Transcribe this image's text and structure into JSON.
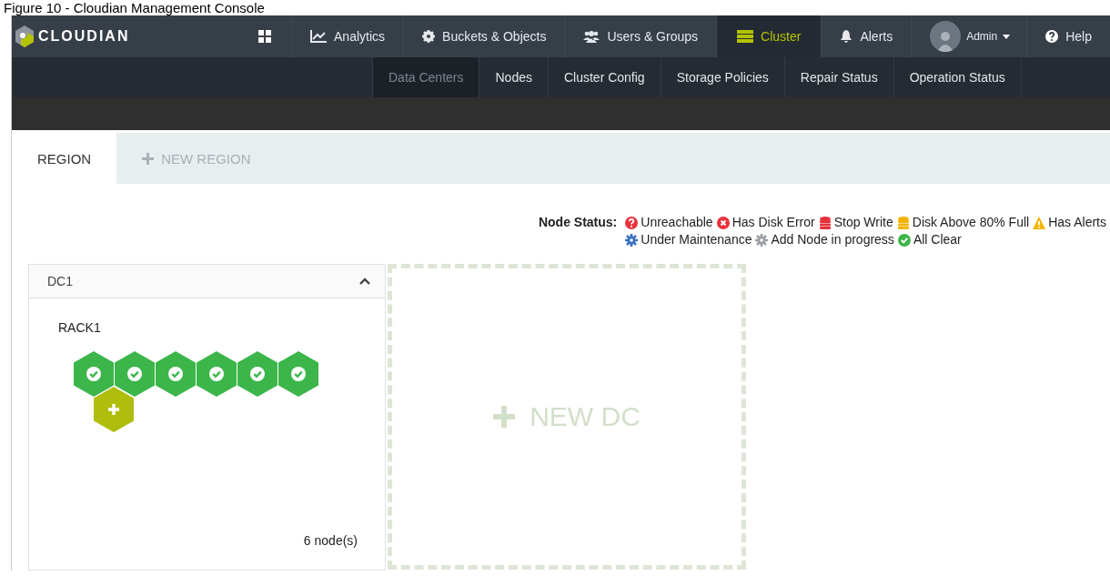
{
  "figure_caption": "Figure 10 - Cloudian Management Console",
  "nav": {
    "logo": "CLOUDIAN",
    "items": [
      {
        "label": "Analytics",
        "selected": false
      },
      {
        "label": "Buckets & Objects",
        "selected": false
      },
      {
        "label": "Users & Groups",
        "selected": false
      },
      {
        "label": "Cluster",
        "selected": true
      },
      {
        "label": "Alerts",
        "selected": false
      }
    ],
    "user_menu": {
      "label": "Admin"
    },
    "help": {
      "label": "Help"
    }
  },
  "subnav": [
    {
      "label": "Data Centers",
      "selected": true
    },
    {
      "label": "Nodes",
      "selected": false
    },
    {
      "label": "Cluster Config",
      "selected": false
    },
    {
      "label": "Storage Policies",
      "selected": false
    },
    {
      "label": "Repair Status",
      "selected": false
    },
    {
      "label": "Operation Status",
      "selected": false
    }
  ],
  "tabs": [
    {
      "label": "REGION",
      "selected": true,
      "kind": "plain"
    },
    {
      "label": "NEW REGION",
      "selected": false,
      "kind": "add"
    }
  ],
  "legend": {
    "title": "Node Status:",
    "entries": [
      {
        "label": "Unreachable",
        "color": "#e8323c"
      },
      {
        "label": "Has Disk Error",
        "color": "#e8323c"
      },
      {
        "label": "Stop Write",
        "color": "#e8323c"
      },
      {
        "label": "Disk Above 80% Full",
        "color": "#f4b400"
      },
      {
        "label": "Has Alerts",
        "color": "#f4b400"
      },
      {
        "label": "Under Maintenance",
        "color": "#3a6fc4"
      },
      {
        "label": "Add Node in progress",
        "color": "#9aa0a6"
      },
      {
        "label": "All Clear",
        "color": "#3cb54a"
      }
    ]
  },
  "data_center": {
    "title": "DC1",
    "expanded": true,
    "rack": "RACK1",
    "nodes": [
      {
        "kind": "ok"
      },
      {
        "kind": "ok"
      },
      {
        "kind": "ok"
      },
      {
        "kind": "ok"
      },
      {
        "kind": "ok"
      },
      {
        "kind": "ok"
      },
      {
        "kind": "add"
      }
    ],
    "node_count": "6 node(s)"
  },
  "new_dc": {
    "label": "NEW DC"
  }
}
